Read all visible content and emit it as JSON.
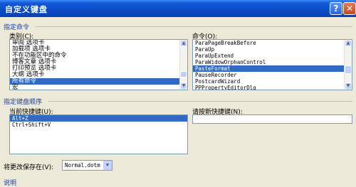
{
  "window": {
    "title": "自定义键盘",
    "help_glyph": "?",
    "close_glyph": "✕"
  },
  "commands_section": {
    "title": "指定命令",
    "category_label": "类别(C):",
    "categories": [
      "审阅 选项卡",
      "加载项 选项卡",
      "不在功能区中的命令",
      "博客文章 选项卡",
      "打印预览 选项卡",
      "大纲 选项卡",
      "所有命令",
      "宏"
    ],
    "selected_category": 6,
    "command_label": "命令(O):",
    "commands": [
      "ParaPageBreakBefore",
      "ParaUp",
      "ParaUpExtend",
      "ParaWidowOrphanControl",
      "PasteFormat",
      "PauseRecorder",
      "PostcardWizard",
      "PPPropertyEditorDlg"
    ],
    "selected_command": 4
  },
  "keys_section": {
    "title": "指定键盘顺序",
    "current_keys_label": "当前快捷键(U):",
    "current_keys": [
      "Alt+Z",
      "Ctrl+Shift+V"
    ],
    "selected_key": 0,
    "new_key_label": "请按新快捷键(N):",
    "new_key_value": ""
  },
  "save_in": {
    "label": "将更改保存在(V):",
    "value": "Normal.dotm"
  },
  "description": {
    "title": "说明"
  }
}
